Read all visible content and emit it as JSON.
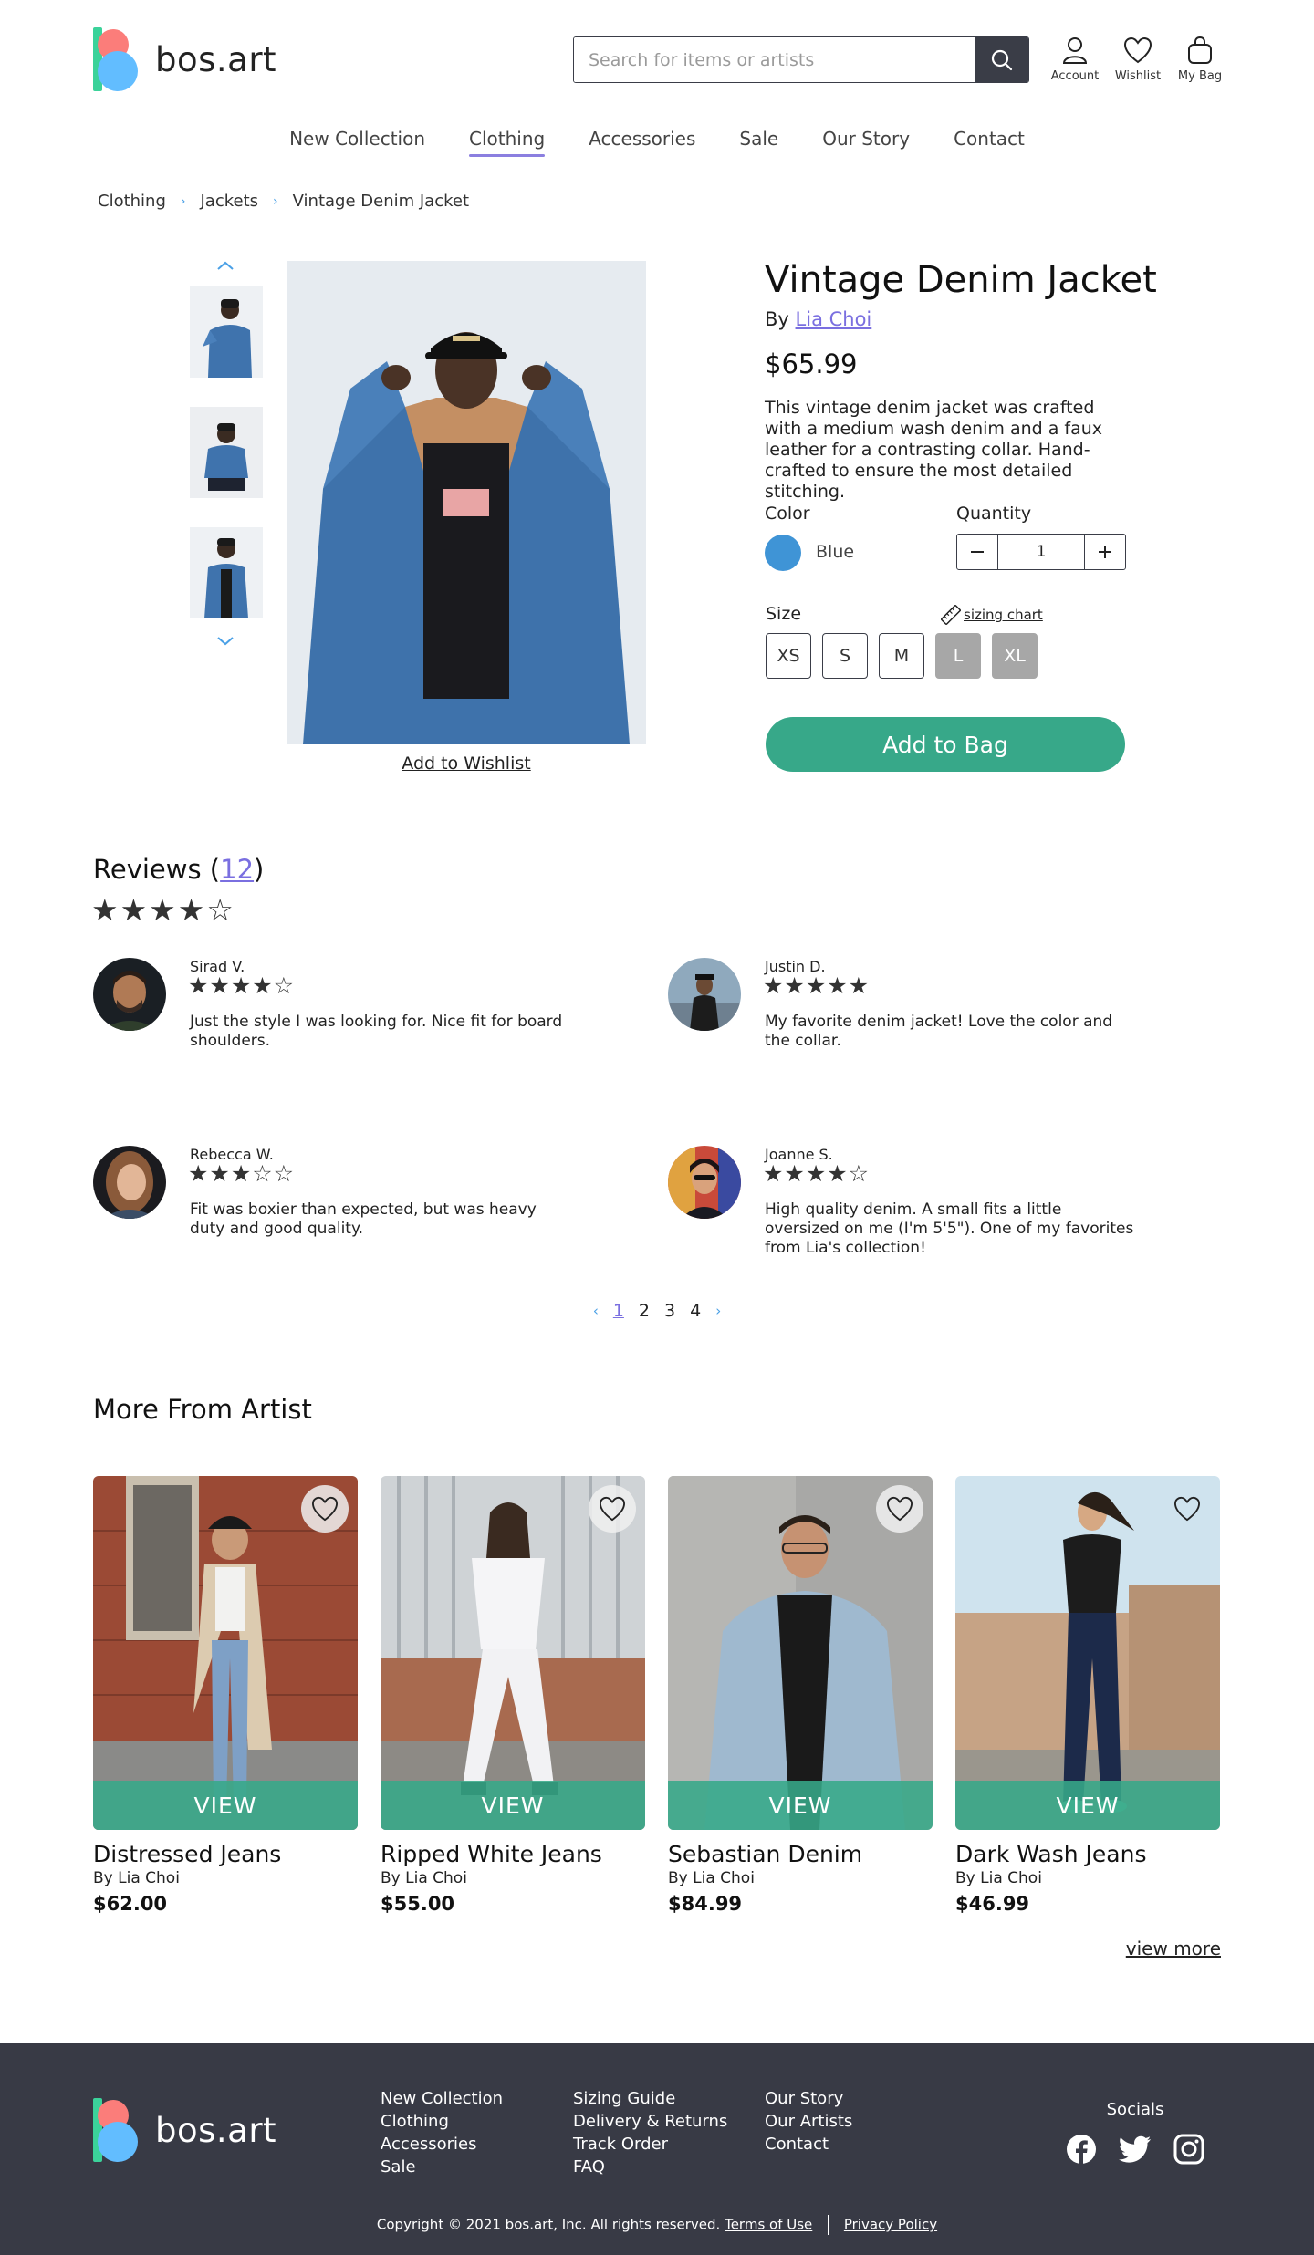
{
  "brand": {
    "name": "bos.art",
    "colors": {
      "green": "#3bd29a",
      "coral": "#fb7d7a",
      "blue": "#62bdff",
      "accent": "#37a889",
      "link": "#7a6fe0"
    }
  },
  "header": {
    "search_placeholder": "Search for items or artists",
    "icons": [
      {
        "label": "Account",
        "icon": "user-icon"
      },
      {
        "label": "Wishlist",
        "icon": "heart-icon"
      },
      {
        "label": "My Bag",
        "icon": "bag-icon"
      }
    ]
  },
  "nav": {
    "items": [
      "New Collection",
      "Clothing",
      "Accessories",
      "Sale",
      "Our Story",
      "Contact"
    ],
    "active": "Clothing"
  },
  "breadcrumb": [
    "Clothing",
    "Jackets",
    "Vintage Denim Jacket"
  ],
  "product": {
    "title": "Vintage Denim Jacket",
    "by_prefix": "By",
    "artist": "Lia Choi",
    "price": "$65.99",
    "description": "This vintage denim jacket was crafted with a medium wash denim and a faux leather for a contrasting collar. Hand-crafted to ensure the most detailed stitching.",
    "color_label": "Color",
    "color_value": "Blue",
    "color_hex": "#3f94d6",
    "quantity_label": "Quantity",
    "quantity": "1",
    "size_label": "Size",
    "sizing_chart": "sizing chart",
    "sizes": [
      {
        "label": "XS",
        "available": true
      },
      {
        "label": "S",
        "available": true
      },
      {
        "label": "M",
        "available": true
      },
      {
        "label": "L",
        "available": false
      },
      {
        "label": "XL",
        "available": false
      }
    ],
    "add_to_bag": "Add to Bag",
    "add_to_wishlist": "Add to Wishlist"
  },
  "reviews": {
    "title": "Reviews",
    "count": "12",
    "rating_stars": "★★★★☆",
    "items": [
      {
        "name": "Sirad V.",
        "stars": "★★★★☆",
        "text": "Just the style I was looking for. Nice fit for board shoulders."
      },
      {
        "name": "Justin D.",
        "stars": "★★★★★",
        "text": "My favorite denim jacket! Love the color and the collar."
      },
      {
        "name": "Rebecca W.",
        "stars": "★★★☆☆",
        "text": "Fit was boxier than expected, but was heavy duty and good quality."
      },
      {
        "name": "Joanne S.",
        "stars": "★★★★☆",
        "text": "High quality denim. A small fits a little oversized on me (I'm 5'5\"). One of my favorites from Lia's collection!"
      }
    ],
    "pages": [
      "1",
      "2",
      "3",
      "4"
    ],
    "current_page": "1"
  },
  "more": {
    "title": "More From Artist",
    "view_label": "VIEW",
    "items": [
      {
        "name": "Distressed Jeans",
        "by": "By Lia Choi",
        "price": "$62.00"
      },
      {
        "name": "Ripped White Jeans",
        "by": "By Lia Choi",
        "price": "$55.00"
      },
      {
        "name": "Sebastian Denim",
        "by": "By Lia Choi",
        "price": "$84.99"
      },
      {
        "name": "Dark Wash Jeans",
        "by": "By Lia Choi",
        "price": "$46.99"
      }
    ],
    "view_more": "view more"
  },
  "footer": {
    "col1": [
      "New Collection",
      "Clothing",
      "Accessories",
      "Sale"
    ],
    "col2": [
      "Sizing Guide",
      "Delivery & Returns",
      "Track Order",
      "FAQ"
    ],
    "col3": [
      "Our Story",
      "Our Artists",
      "Contact"
    ],
    "socials_title": "Socials",
    "socials": [
      "facebook-icon",
      "twitter-icon",
      "instagram-icon"
    ],
    "copyright": "Copyright © 2021 bos.art, Inc. All rights reserved.",
    "terms": "Terms of Use",
    "privacy": "Privacy Policy"
  }
}
